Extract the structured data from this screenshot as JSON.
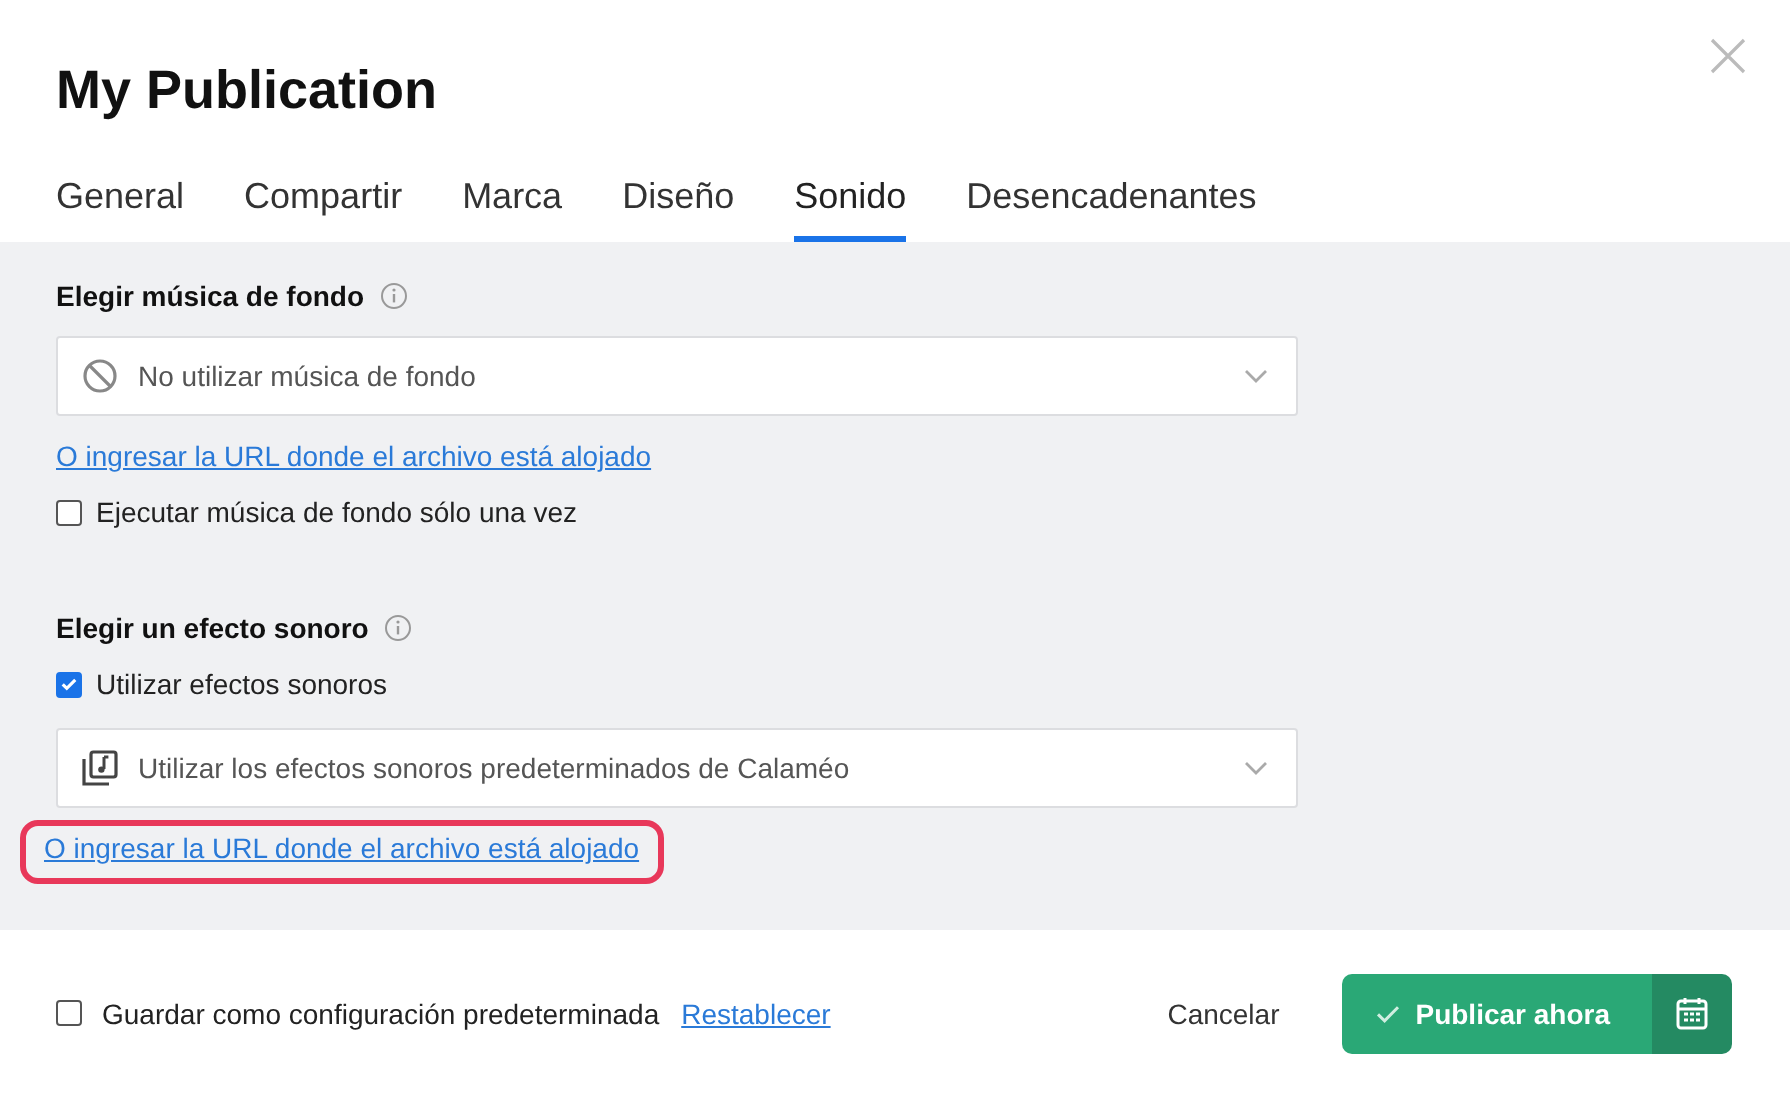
{
  "window": {
    "title": "My Publication"
  },
  "tabs": [
    {
      "label": "General",
      "selected": false
    },
    {
      "label": "Compartir",
      "selected": false
    },
    {
      "label": "Marca",
      "selected": false
    },
    {
      "label": "Diseño",
      "selected": false
    },
    {
      "label": "Sonido",
      "selected": true
    },
    {
      "label": "Desencadenantes",
      "selected": false
    }
  ],
  "sections": [
    {
      "title": "Elegir música de fondo",
      "items": [
        {
          "kind": "select",
          "value": "No utilizar música de fondo"
        },
        {
          "kind": "link",
          "label": "O ingresar la URL donde el archivo está alojado",
          "highlighted": false
        },
        {
          "kind": "checkbox",
          "label": "Ejecutar música de fondo sólo una vez",
          "checked": false
        }
      ]
    },
    {
      "title": "Elegir un efecto sonoro",
      "items": [
        {
          "kind": "checkbox",
          "label": "Utilizar efectos sonoros",
          "checked": true
        },
        {
          "kind": "select",
          "value": "Utilizar los efectos sonoros predeterminados de Calaméo"
        },
        {
          "kind": "link",
          "label": "O ingresar la URL donde el archivo está alojado",
          "highlighted": true
        }
      ]
    }
  ],
  "footer": {
    "checkbox": {
      "label": "Guardar como configuración predeterminada",
      "checked": false
    },
    "reset_link": "Restablecer",
    "cancel": "Cancelar",
    "publish": "Publicar ahora"
  }
}
